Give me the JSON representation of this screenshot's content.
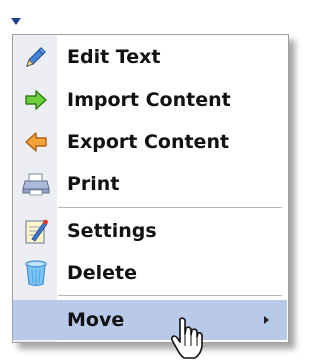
{
  "menu": {
    "items": [
      {
        "label": "Edit Text",
        "icon": "pencil-icon"
      },
      {
        "label": "Import Content",
        "icon": "arrow-right-green-icon"
      },
      {
        "label": "Export Content",
        "icon": "arrow-left-orange-icon"
      },
      {
        "label": "Print",
        "icon": "printer-icon"
      },
      {
        "label": "Settings",
        "icon": "settings-note-icon"
      },
      {
        "label": "Delete",
        "icon": "trash-can-icon"
      },
      {
        "label": "Move",
        "icon": "submenu-arrow-icon",
        "state": "hover"
      }
    ]
  },
  "colors": {
    "hover_bg": "#b9c9ea",
    "icon_strip": "#eceef3",
    "caret": "#1f3f86"
  }
}
